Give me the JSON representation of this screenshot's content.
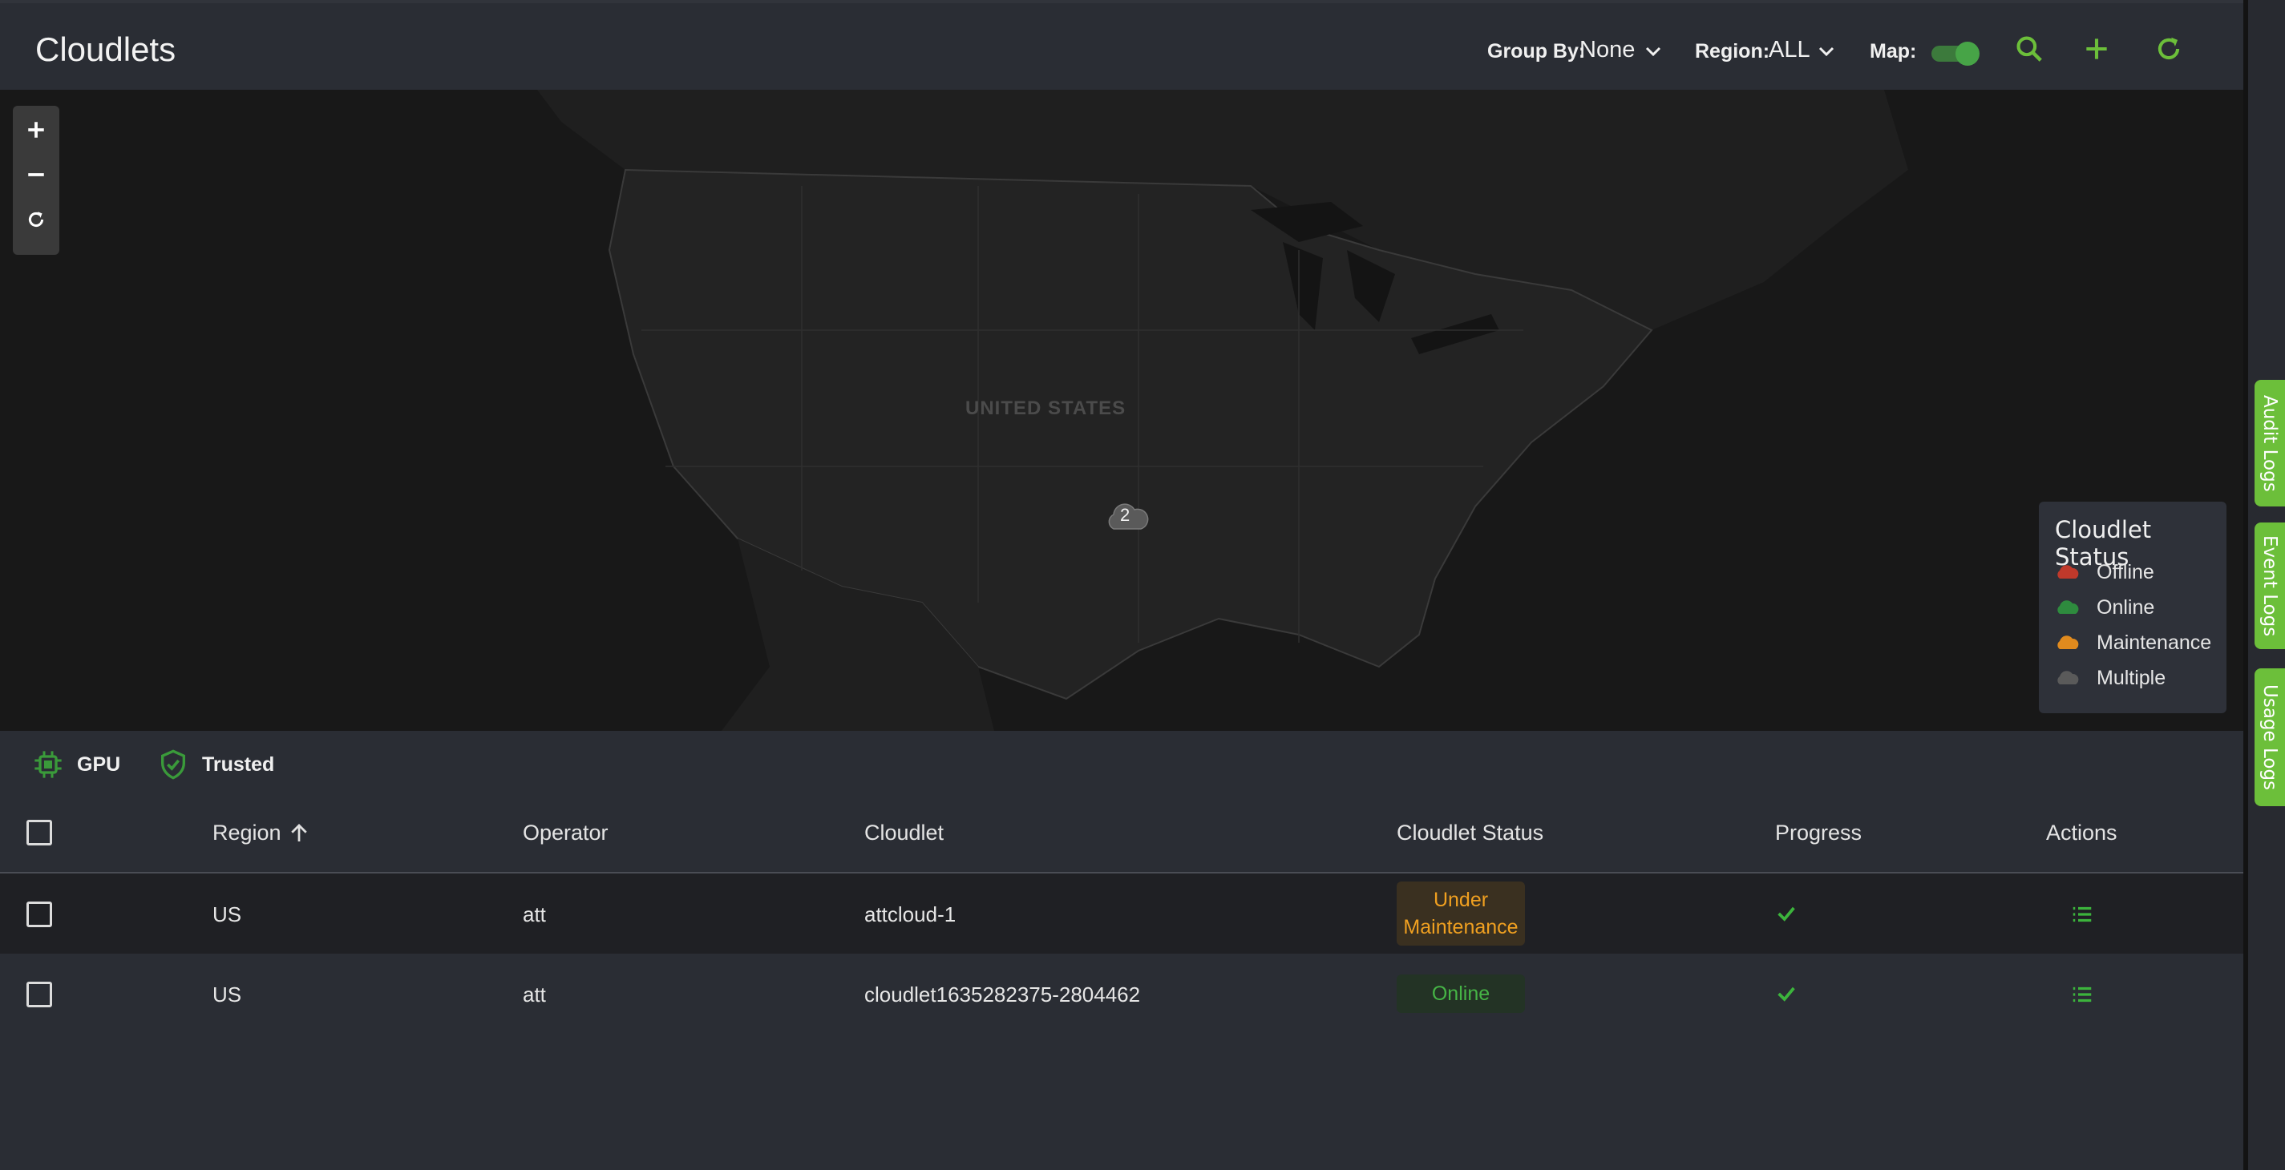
{
  "header": {
    "title": "Cloudlets",
    "group_by_label": "Group By:",
    "group_by_value": "None",
    "region_label": "Region:",
    "region_value": "ALL",
    "map_label": "Map:",
    "map_enabled": true,
    "icons": [
      "search-icon",
      "add-icon",
      "refresh-icon"
    ],
    "accent_color": "#6cbf3a"
  },
  "map": {
    "country_label": "UNITED STATES",
    "cluster_count": "2",
    "zoom_controls": [
      "zoom-in-icon",
      "zoom-out-icon",
      "reset-view-icon"
    ],
    "legend": {
      "title": "Cloudlet Status",
      "items": [
        {
          "label": "Offline",
          "color": "#c0392b"
        },
        {
          "label": "Online",
          "color": "#2e8b3e"
        },
        {
          "label": "Maintenance",
          "color": "#e08a1e"
        },
        {
          "label": "Multiple",
          "color": "#5a5a5a"
        }
      ]
    }
  },
  "filters": [
    {
      "label": "GPU",
      "icon": "gpu-chip-icon"
    },
    {
      "label": "Trusted",
      "icon": "shield-check-icon"
    }
  ],
  "table": {
    "columns": [
      "Region",
      "Operator",
      "Cloudlet",
      "Cloudlet Status",
      "Progress",
      "Actions"
    ],
    "sort": {
      "column": "Region",
      "direction": "ascending"
    },
    "rows": [
      {
        "region": "US",
        "operator": "att",
        "cloudlet": "attcloud-1",
        "status_line1": "Under",
        "status_line2": "Maintenance",
        "status": "maintenance",
        "progress": "complete"
      },
      {
        "region": "US",
        "operator": "att",
        "cloudlet": "cloudlet1635282375-2804462",
        "status_line1": "Online",
        "status": "online",
        "progress": "complete"
      }
    ]
  },
  "side_tabs": [
    "Audit Logs",
    "Event Logs",
    "Usage Logs"
  ]
}
